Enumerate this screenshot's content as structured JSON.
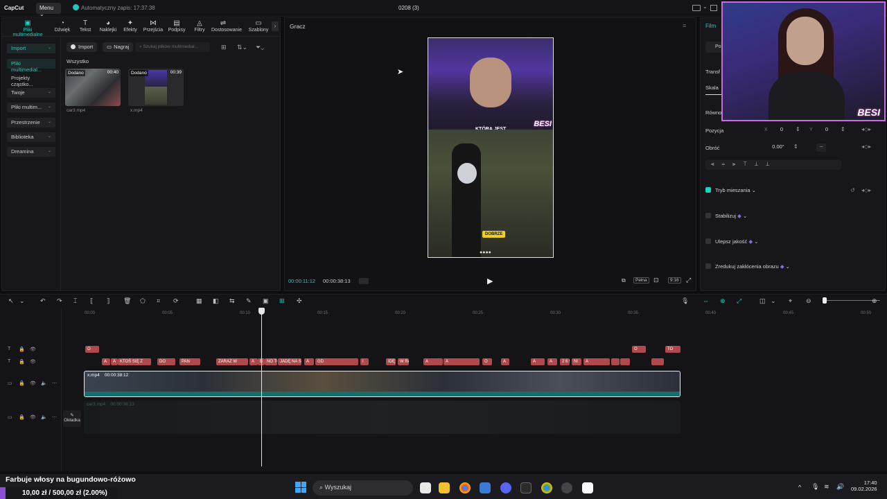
{
  "app": {
    "logo": "CapCut",
    "menu": "Menu",
    "autosave": "Automatyczny zapis: 17:37:38",
    "project_title": "0208 (3)"
  },
  "toolbar": [
    {
      "label": "Pliki multimedialne",
      "icon": "media-icon",
      "active": true
    },
    {
      "label": "Dźwięk",
      "icon": "audio-icon"
    },
    {
      "label": "Tekst",
      "icon": "text-icon"
    },
    {
      "label": "Naklejki",
      "icon": "sticker-icon"
    },
    {
      "label": "Efekty",
      "icon": "effects-icon"
    },
    {
      "label": "Przejścia",
      "icon": "transition-icon"
    },
    {
      "label": "Podpisy",
      "icon": "captions-icon"
    },
    {
      "label": "Filtry",
      "icon": "filter-icon"
    },
    {
      "label": "Dostosowanie",
      "icon": "adjust-icon"
    },
    {
      "label": "Szablony",
      "icon": "template-icon"
    }
  ],
  "sidebar": [
    {
      "label": "Import",
      "boxed": true,
      "selected": true
    },
    {
      "label": "Pliki multimedial...",
      "selected": true
    },
    {
      "label": "Projekty cząstko..."
    },
    {
      "label": "Twoje",
      "boxed": true
    },
    {
      "label": "Pliki multim...",
      "boxed": true
    },
    {
      "label": "Przestrzenie",
      "boxed": true
    },
    {
      "label": "Biblioteka",
      "boxed": true
    },
    {
      "label": "Dreamina",
      "boxed": true
    }
  ],
  "media": {
    "import_button": "Import",
    "record_button": "Nagraj",
    "search_placeholder": "Szukaj plików multimedial...",
    "section": "Wszystko",
    "items": [
      {
        "tag": "Dodano",
        "duration": "00:40",
        "name": "car3.mp4"
      },
      {
        "tag": "Dodano",
        "duration": "00:39",
        "name": "x.mp4"
      }
    ]
  },
  "player": {
    "label": "Gracz",
    "current_time": "00:00:11:12",
    "total_time": "00:00:38:13",
    "full_label": "Pełna",
    "ratio": "9:16",
    "subtitle_top": "KTÓRĄ JEST",
    "besi": "BESI",
    "sticker": "DOBRZE"
  },
  "inspector": {
    "tab": "Film",
    "transform": "Transf",
    "scale": "Skala",
    "uniform": "Równo",
    "position_label": "Pozycja",
    "x_label": "X",
    "x_value": "0",
    "y_label": "Y",
    "y_value": "0",
    "rotate_label": "Obróć",
    "rotate_value": "0.00°",
    "blend": "Tryb mieszania",
    "stabilize": "Stabilizuj",
    "enhance": "Ulepsz jakość",
    "denoise": "Zredukuj zakłócenia obrazu"
  },
  "timeline": {
    "ticks": [
      "00:00",
      "00:05",
      "00:10",
      "00:15",
      "00:20",
      "00:25",
      "00:30",
      "00:35",
      "00:40",
      "00:45",
      "00:50"
    ],
    "video_label": "x.mp4",
    "video_duration": "00:00:38:12",
    "audio_label": "car3.mp4",
    "audio_duration": "00:00:38:13",
    "cover": "Okładka",
    "text_row1": [
      "O",
      "O",
      "TO"
    ],
    "text_row2": [
      "A",
      "A",
      "KTOŚ SIĘ Z",
      "DO",
      "PAN",
      "ZARAZ W",
      "A",
      "B",
      "NO TO",
      "JADĘ NA SPOT",
      "A",
      "GD",
      "I",
      "IDĘ S",
      "W RAZIE CZ",
      "A",
      "A",
      "O",
      "A",
      "A",
      "A",
      "2 6 9 0",
      "NI",
      "A"
    ]
  },
  "overlay": {
    "notice": "Farbuje włosy na bugundowo-różowo",
    "progress": "10,00 zł / 500,00 zł (2.00%)",
    "progress_fraction": 0.02
  },
  "taskbar": {
    "search": "Wyszukaj",
    "time": "17:40",
    "date": "09.02.2026"
  },
  "colors": {
    "accent": "#19d4c6",
    "text_clip": "#b0484c",
    "webcam_border": "#c86ee0"
  }
}
